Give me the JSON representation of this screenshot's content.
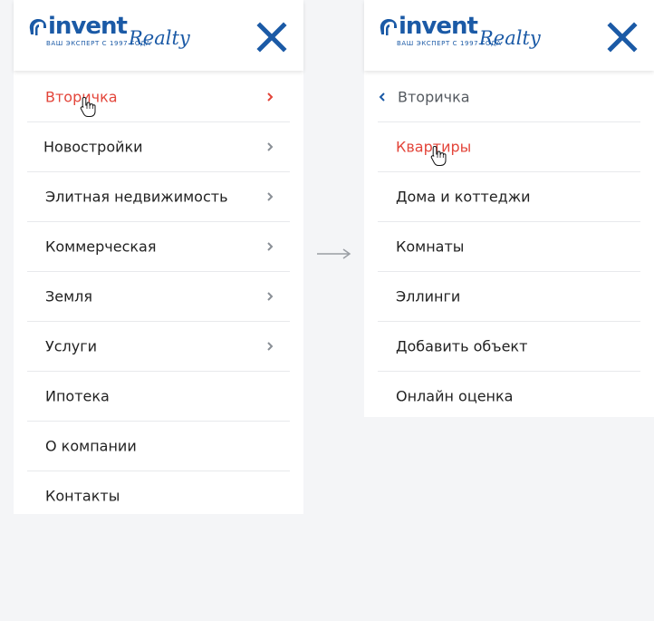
{
  "brand": {
    "name": "invent",
    "script": "Realty",
    "tagline": "ВАШ ЭКСПЕРТ С 1997 ГОДА",
    "primary_color": "#1b5aa6",
    "accent_color": "#e3453a"
  },
  "left_panel": {
    "close_icon": "close-icon",
    "items": [
      {
        "label": "Вторичка",
        "active": true,
        "has_submenu": true
      },
      {
        "label": "Новостройки",
        "active": false,
        "has_submenu": true
      },
      {
        "label": "Элитная недвижимость",
        "active": false,
        "has_submenu": true
      },
      {
        "label": "Коммерческая",
        "active": false,
        "has_submenu": true
      },
      {
        "label": "Земля",
        "active": false,
        "has_submenu": true
      },
      {
        "label": "Услуги",
        "active": false,
        "has_submenu": true
      },
      {
        "label": "Ипотека",
        "active": false,
        "has_submenu": false
      },
      {
        "label": "О компании",
        "active": false,
        "has_submenu": false
      },
      {
        "label": "Контакты",
        "active": false,
        "has_submenu": false
      }
    ]
  },
  "transition_icon": "right-arrow-icon",
  "right_panel": {
    "close_icon": "close-icon",
    "back_label": "Вторичка",
    "items": [
      {
        "label": "Квартиры",
        "active": true
      },
      {
        "label": "Дома и коттеджи",
        "active": false
      },
      {
        "label": "Комнаты",
        "active": false
      },
      {
        "label": "Эллинги",
        "active": false
      },
      {
        "label": "Добавить объект",
        "active": false
      },
      {
        "label": "Онлайн оценка",
        "active": false
      }
    ]
  }
}
